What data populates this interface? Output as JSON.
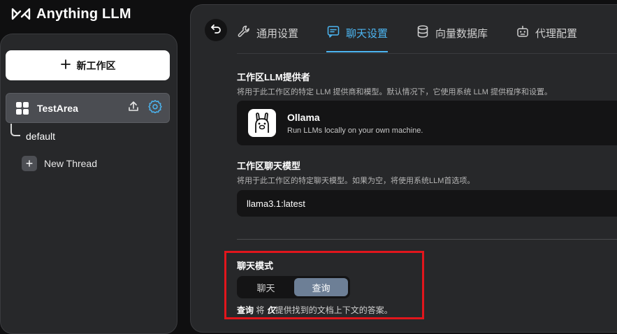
{
  "app": {
    "name": "Anything LLM"
  },
  "sidebar": {
    "new_workspace_label": "新工作区",
    "workspace": {
      "name": "TestArea"
    },
    "thread_default": "default",
    "new_thread_label": "New Thread"
  },
  "tabs": [
    {
      "label": "通用设置",
      "icon": "wrench-icon",
      "active": false
    },
    {
      "label": "聊天设置",
      "icon": "chat-icon",
      "active": true
    },
    {
      "label": "向量数据库",
      "icon": "database-icon",
      "active": false
    },
    {
      "label": "代理配置",
      "icon": "robot-icon",
      "active": false
    }
  ],
  "provider_section": {
    "title": "工作区LLM提供者",
    "description": "将用于此工作区的特定 LLM 提供商和模型。默认情况下，它使用系统 LLM 提供程序和设置。",
    "provider_name": "Ollama",
    "provider_desc": "Run LLMs locally on your own machine."
  },
  "model_section": {
    "title": "工作区聊天模型",
    "description": "将用于此工作区的特定聊天模型。如果为空，将使用系统LLM首选项。",
    "selected_model": "llama3.1:latest"
  },
  "chat_mode": {
    "title": "聊天模式",
    "options": [
      "聊天",
      "查询"
    ],
    "selected": "查询",
    "desc_bold": "查询",
    "desc_mid": " 将 ",
    "desc_italic": "仅",
    "desc_end": "提供找到的文档上下文的答案。"
  },
  "colors": {
    "accent": "#4cb6f2",
    "highlight": "#e1161c",
    "selected_toggle": "#6d7f96"
  }
}
